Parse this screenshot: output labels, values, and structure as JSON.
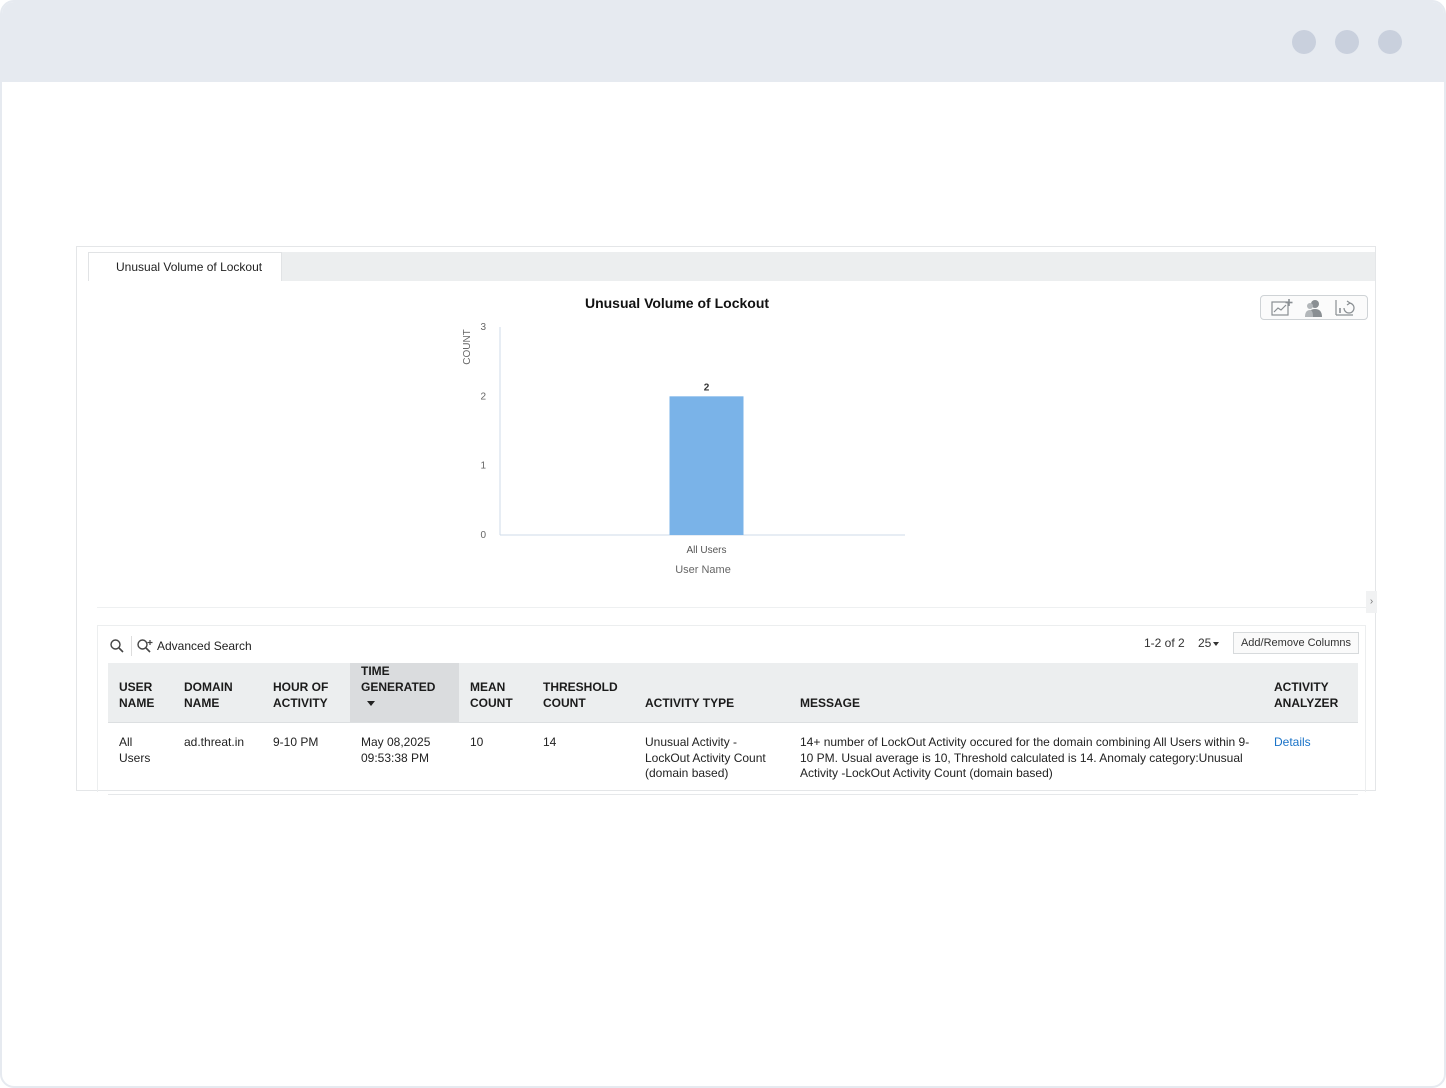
{
  "tab": {
    "label": "Unusual Volume of Lockout"
  },
  "chart_data": {
    "type": "bar",
    "title": "Unusual Volume of Lockout",
    "xlabel": "User Name",
    "ylabel": "COUNT",
    "categories": [
      "All Users"
    ],
    "values": [
      2
    ],
    "data_labels": [
      "2"
    ],
    "ylim": [
      0,
      3
    ],
    "yticks": [
      0,
      1,
      2,
      3
    ],
    "grid": false,
    "bar_color": "#7ab3e8"
  },
  "toolbar": {
    "advanced_search_label": "Advanced Search",
    "pager_text": "1-2 of 2",
    "page_size": "25",
    "add_remove_columns_label": "Add/Remove Columns"
  },
  "table": {
    "columns": [
      {
        "line1": "USER",
        "line2": "NAME"
      },
      {
        "line1": "DOMAIN",
        "line2": "NAME"
      },
      {
        "line1": "HOUR OF",
        "line2": "ACTIVITY"
      },
      {
        "line1": "TIME",
        "line2": "GENERATED"
      },
      {
        "line1": "MEAN",
        "line2": "COUNT"
      },
      {
        "line1": "THRESHOLD",
        "line2": "COUNT"
      },
      {
        "line1": "",
        "line2": "ACTIVITY TYPE"
      },
      {
        "line1": "",
        "line2": "MESSAGE"
      },
      {
        "line1": "ACTIVITY",
        "line2": "ANALYZER"
      }
    ],
    "rows": [
      {
        "user_name": "All Users",
        "domain_name": "ad.threat.in",
        "hour_of_activity": "9-10 PM",
        "time_generated": "May 08,2025 09:53:38 PM",
        "mean_count": "10",
        "threshold_count": "14",
        "activity_type": "Unusual Activity -LockOut Activity Count (domain based)",
        "message": "14+ number of LockOut Activity occured for the domain combining All Users within 9-10 PM. Usual average is 10, Threshold calculated is 14. Anomaly category:Unusual Activity -LockOut Activity Count (domain based)",
        "activity_analyzer": "Details"
      }
    ]
  }
}
